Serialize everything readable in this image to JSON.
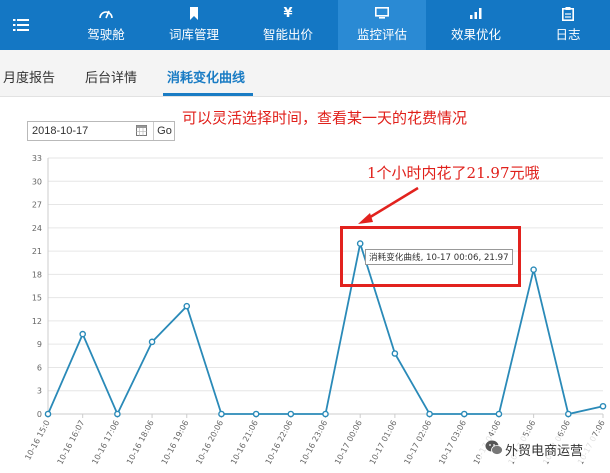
{
  "nav": {
    "items": [
      {
        "label": "驾驶舱",
        "icon": "dashboard-gauge-icon"
      },
      {
        "label": "词库管理",
        "icon": "bookmark-icon"
      },
      {
        "label": "智能出价",
        "icon": "yen-icon"
      },
      {
        "label": "监控评估",
        "icon": "monitor-icon",
        "active": true
      },
      {
        "label": "效果优化",
        "icon": "bar-chart-icon"
      },
      {
        "label": "日志",
        "icon": "clipboard-icon"
      }
    ],
    "menu_icon": "hamburger-menu-icon",
    "bar_color": "#1477c4",
    "active_color": "#2a8ad4"
  },
  "subtabs": [
    {
      "label": "月度报告"
    },
    {
      "label": "后台详情"
    },
    {
      "label": "消耗变化曲线",
      "active": true
    }
  ],
  "date_picker": {
    "value": "2018-10-17",
    "go_label": "Go",
    "icon": "calendar-icon"
  },
  "annotations": {
    "note_top": "可以灵活选择时间，查看某一天的花费情况",
    "note_mid": "1个小时内花了21.97元哦",
    "color": "#e0201b"
  },
  "tooltip": {
    "text": "消耗变化曲线, 10-17 00:06, 21.97"
  },
  "watermark": {
    "text": "外贸电商运营",
    "icon": "wechat-icon"
  },
  "chart_data": {
    "type": "line",
    "series": [
      {
        "name": "消耗变化曲线",
        "color": "#2a8ab8",
        "values": [
          0,
          10.3,
          0,
          9.3,
          13.9,
          0,
          0,
          0,
          0,
          21.97,
          7.8,
          0,
          0,
          0,
          18.6,
          0,
          1
        ]
      }
    ],
    "categories": [
      "10-16 15:0",
      "10-16 16:07",
      "10-16 17:06",
      "10-16 18:06",
      "10-16 19:06",
      "10-16 20:06",
      "10-16 21:06",
      "10-16 22:06",
      "10-16 23:06",
      "10-17 00:06",
      "10-17 01:06",
      "10-17 02:06",
      "10-17 03:06",
      "10-17 04:06",
      "10-17 05:06",
      "10-17 06:06",
      "10-17 07:06"
    ],
    "yticks": [
      0,
      3,
      6,
      9,
      12,
      15,
      18,
      21,
      24,
      27,
      30,
      33
    ],
    "ylim": [
      0,
      33
    ],
    "grid": true
  }
}
